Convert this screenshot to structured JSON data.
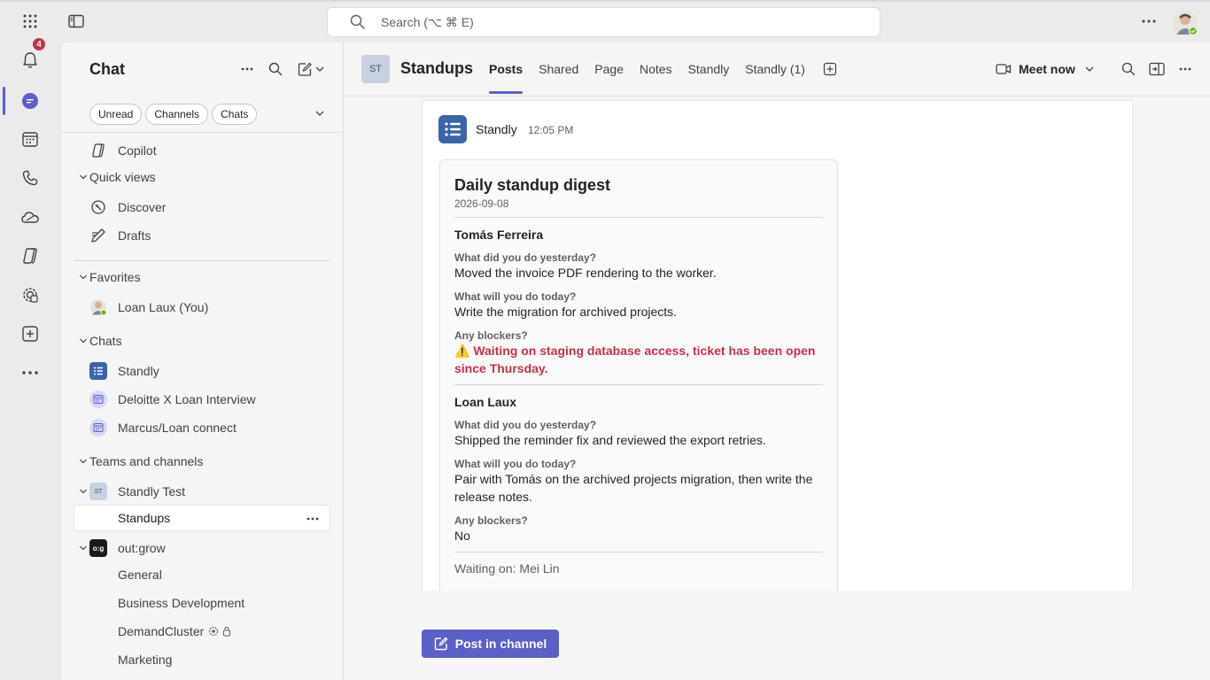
{
  "topbar": {
    "search_placeholder": "Search (⌥ ⌘ E)",
    "more_label": "···"
  },
  "rail": {
    "activity_badge": "4",
    "items": [
      "activity-icon",
      "chat-icon",
      "calendar-icon",
      "calls-icon",
      "onedrive-icon",
      "copilot-icon",
      "apps-icon",
      "add-app-icon",
      "more-icon"
    ]
  },
  "left": {
    "title": "Chat",
    "filters": [
      "Unread",
      "Channels",
      "Chats"
    ],
    "copilot": "Copilot",
    "quick_views": "Quick views",
    "discover": "Discover",
    "drafts": "Drafts",
    "favorites": "Favorites",
    "me": "Loan Laux (You)",
    "chats": "Chats",
    "chat_items": [
      "Standly",
      "Deloitte X Loan Interview",
      "Marcus/Loan connect"
    ],
    "teams_channels": "Teams and channels",
    "team1": "Standly Test",
    "team1_tile": "ST",
    "team1_channel": "Standups",
    "team2": "out:grow",
    "team2_tile": "o:g",
    "team2_channels": [
      "General",
      "Business Development",
      "DemandCluster",
      "Marketing"
    ]
  },
  "main": {
    "tile": "ST",
    "title": "Standups",
    "tabs": [
      "Posts",
      "Shared",
      "Page",
      "Notes",
      "Standly",
      "Standly (1)"
    ],
    "meet_now": "Meet now"
  },
  "post": {
    "author": "Standly",
    "time": "12:05 PM",
    "card": {
      "title": "Daily standup digest",
      "date": "2026-09-08",
      "q_yesterday": "What did you do yesterday?",
      "q_today": "What will you do today?",
      "q_blockers": "Any blockers?",
      "people": [
        {
          "name": "Tomás Ferreira",
          "yesterday": "Moved the invoice PDF rendering to the worker.",
          "today": "Write the migration for archived projects.",
          "blockers": "⚠️ Waiting on staging database access, ticket has been open since Thursday."
        },
        {
          "name": "Loan Laux",
          "yesterday": "Shipped the reminder fix and reviewed the export retries.",
          "today": "Pair with Tomás on the archived projects migration, then write the release notes.",
          "blockers": "No"
        }
      ],
      "waiting": "Waiting on: Mei Lin"
    }
  },
  "post_button": "Post in channel",
  "colors": {
    "accent": "#5b5fc7",
    "blocker": "#c4314b",
    "badge": "#c4314b",
    "standly_blue": "#3b64a8",
    "presence": "#6bb700"
  }
}
